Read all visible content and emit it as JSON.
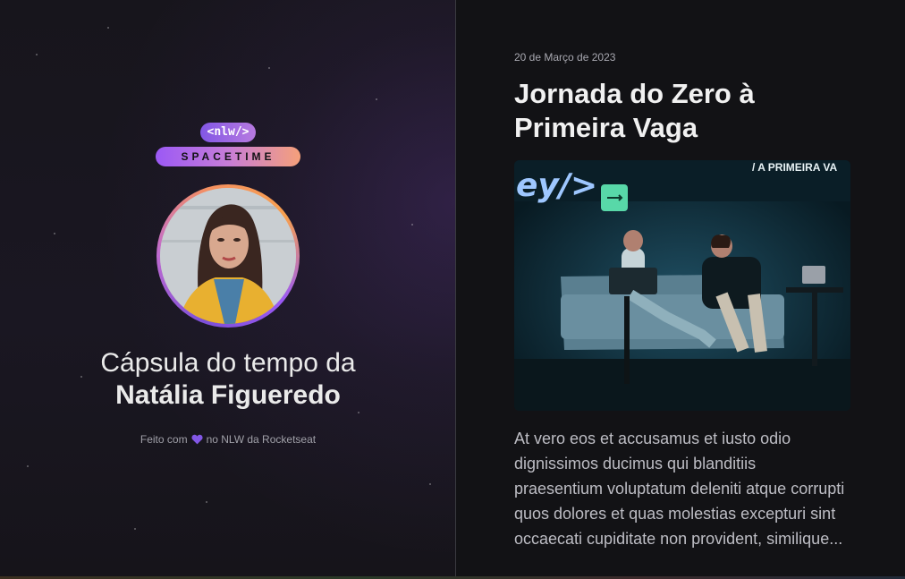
{
  "logo": {
    "tag": "<nlw/>",
    "name": "SPACETIME"
  },
  "profile": {
    "title_prefix": "Cápsula do tempo da",
    "name": "Natália Figueredo"
  },
  "credits": {
    "before": "Feito com",
    "after": "no NLW da Rocketseat",
    "heart_icon": "heart-icon",
    "heart_color": "#8257e5"
  },
  "memory": {
    "date": "20 de Março de 2023",
    "title": "Jornada do Zero à Primeira Vaga",
    "image_banner": "/ A PRIMEIRA VA",
    "image_logo_text": "ey/>",
    "body": "At vero eos et accusamus et iusto odio dignissimos ducimus qui blanditiis praesentium voluptatum deleniti atque corrupti quos dolores et quas molestias excepturi sint occaecati cupiditate non provident, similique..."
  },
  "colors": {
    "background": "#121215",
    "purple": "#8257e5",
    "orange": "#f5a07a"
  }
}
